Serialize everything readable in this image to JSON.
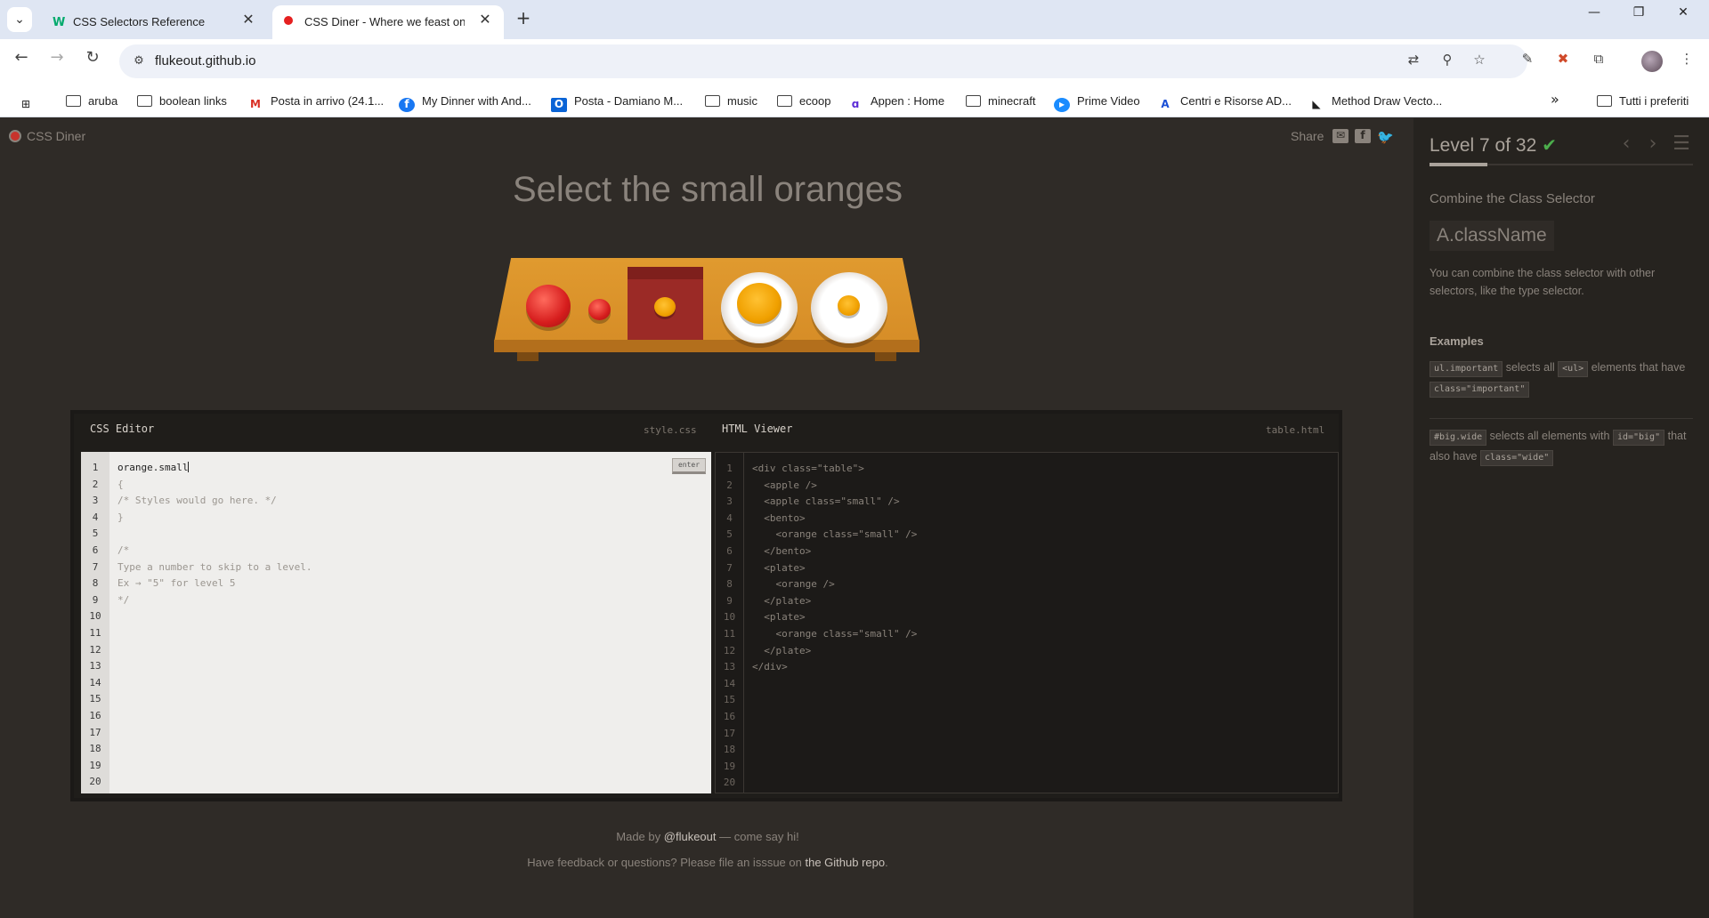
{
  "browser": {
    "tabs": [
      {
        "title": "CSS Selectors Reference",
        "favicon": "w3schools-icon",
        "active": false
      },
      {
        "title": "CSS Diner - Where we feast on",
        "favicon": "css-diner-icon",
        "active": true
      }
    ],
    "url": "flukeout.github.io",
    "bookmarks": [
      {
        "label": "aruba",
        "icon": "folder-icon"
      },
      {
        "label": "boolean links",
        "icon": "folder-icon"
      },
      {
        "label": "Posta in arrivo (24.1...",
        "icon": "gmail-icon"
      },
      {
        "label": "My Dinner with And...",
        "icon": "facebook-icon"
      },
      {
        "label": "Posta - Damiano M...",
        "icon": "outlook-icon"
      },
      {
        "label": "music",
        "icon": "folder-icon"
      },
      {
        "label": "ecoop",
        "icon": "folder-icon"
      },
      {
        "label": "Appen : Home",
        "icon": "appen-icon"
      },
      {
        "label": "minecraft",
        "icon": "folder-icon"
      },
      {
        "label": "Prime Video",
        "icon": "prime-video-icon"
      },
      {
        "label": "Centri e Risorse AD...",
        "icon": "adobe-icon"
      },
      {
        "label": "Method Draw Vecto...",
        "icon": "method-draw-icon"
      }
    ],
    "all_bookmarks": "Tutti i preferiti",
    "more_bookmarks": "»"
  },
  "page": {
    "brand": "CSS Diner",
    "share": "Share",
    "instruction": "Select the small oranges",
    "css_editor": {
      "title": "CSS Editor",
      "file": "style.css",
      "enter": "enter",
      "input": "orange.small",
      "lines": [
        "{",
        "/* Styles would go here. */",
        "}",
        "",
        "/*",
        "Type a number to skip to a level.",
        "Ex → \"5\" for level 5",
        "*/"
      ],
      "line_count": 20
    },
    "html_viewer": {
      "title": "HTML Viewer",
      "file": "table.html",
      "lines": [
        "<div class=\"table\">",
        "  <apple />",
        "  <apple class=\"small\" />",
        "  <bento>",
        "    <orange class=\"small\" />",
        "  </bento>",
        "  <plate>",
        "    <orange />",
        "  </plate>",
        "  <plate>",
        "    <orange class=\"small\" />",
        "  </plate>",
        "</div>"
      ],
      "line_count": 20
    },
    "footer": {
      "made_by_prefix": "Made by",
      "made_by_link": "@flukeout",
      "made_by_suffix": "— come say hi!",
      "feedback_prefix": "Have feedback or questions? Please file an isssue on",
      "feedback_link": "the Github repo",
      "feedback_suffix": "."
    }
  },
  "sidebar": {
    "level_text": "Level 7 of 32",
    "level_current": 7,
    "level_total": 32,
    "completed": true,
    "title": "Combine the Class Selector",
    "selector": "A.className",
    "description": "You can combine the class selector with other selectors, like the type selector.",
    "examples_title": "Examples",
    "examples": [
      {
        "code": "ul.important",
        "t1": "selects all",
        "code2": "<ul>",
        "t2": "elements that have",
        "code3": "class=\"important\"",
        "t3": ""
      },
      {
        "code": "#big.wide",
        "t1": "selects all elements with",
        "code2": "id=\"big\"",
        "t2": "that also have",
        "code3": "class=\"wide\"",
        "t3": ""
      }
    ]
  },
  "colors": {
    "background": "#2f2b27",
    "sidebar": "#26231f",
    "accent_check": "#4cae4c"
  }
}
